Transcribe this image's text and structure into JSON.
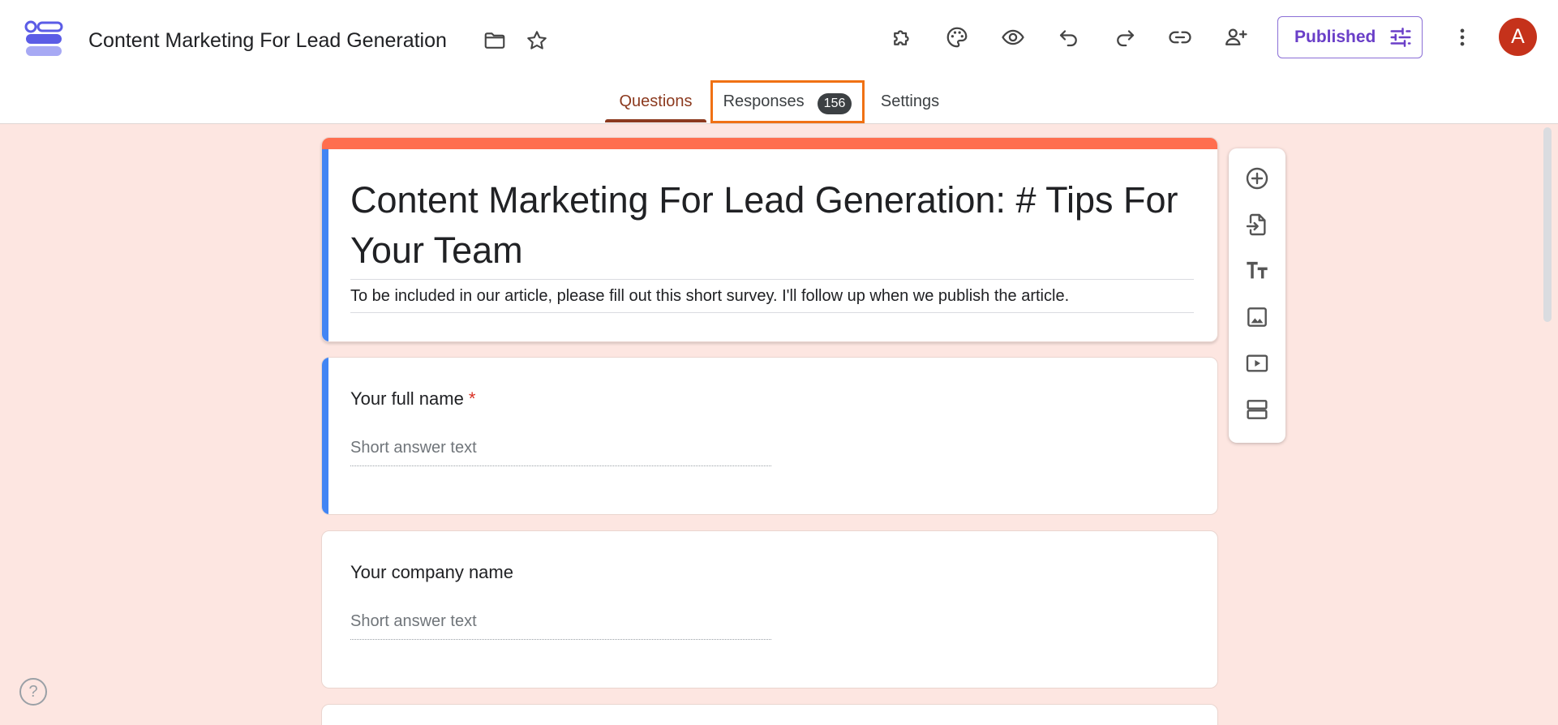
{
  "header": {
    "doc_title": "Content Marketing For Lead Generation",
    "publish_label": "Published",
    "avatar_initial": "A"
  },
  "tabs": {
    "questions": "Questions",
    "responses": "Responses",
    "responses_count": "156",
    "settings": "Settings"
  },
  "form": {
    "title": "Content Marketing For Lead Generation: # Tips For Your Team",
    "description": "To be included in our article, please fill out this short survey. I'll follow up when we publish the article."
  },
  "questions": [
    {
      "label": "Your full name",
      "required_mark": "*",
      "placeholder": "Short answer text"
    },
    {
      "label": "Your company name",
      "placeholder": "Short answer text"
    }
  ],
  "help": {
    "glyph": "?"
  },
  "icons": {
    "header": [
      "forms-logo-icon",
      "folder-icon",
      "star-icon",
      "addon-puzzle-icon",
      "palette-icon",
      "preview-eye-icon",
      "undo-icon",
      "redo-icon",
      "link-icon",
      "add-collaborator-icon",
      "sliders-icon",
      "more-vert-icon"
    ],
    "side_toolbar": [
      "add-question-icon",
      "import-questions-icon",
      "add-title-icon",
      "add-image-icon",
      "add-video-icon",
      "add-section-icon"
    ]
  },
  "colors": {
    "accent_blue": "#4285f4",
    "theme_band": "#ff6e4f",
    "background": "#fde6e1",
    "active_tab": "#8c3a1f",
    "highlight_outline": "#f07114",
    "publish_purple": "#6a3fc8",
    "avatar": "#c5321b"
  }
}
